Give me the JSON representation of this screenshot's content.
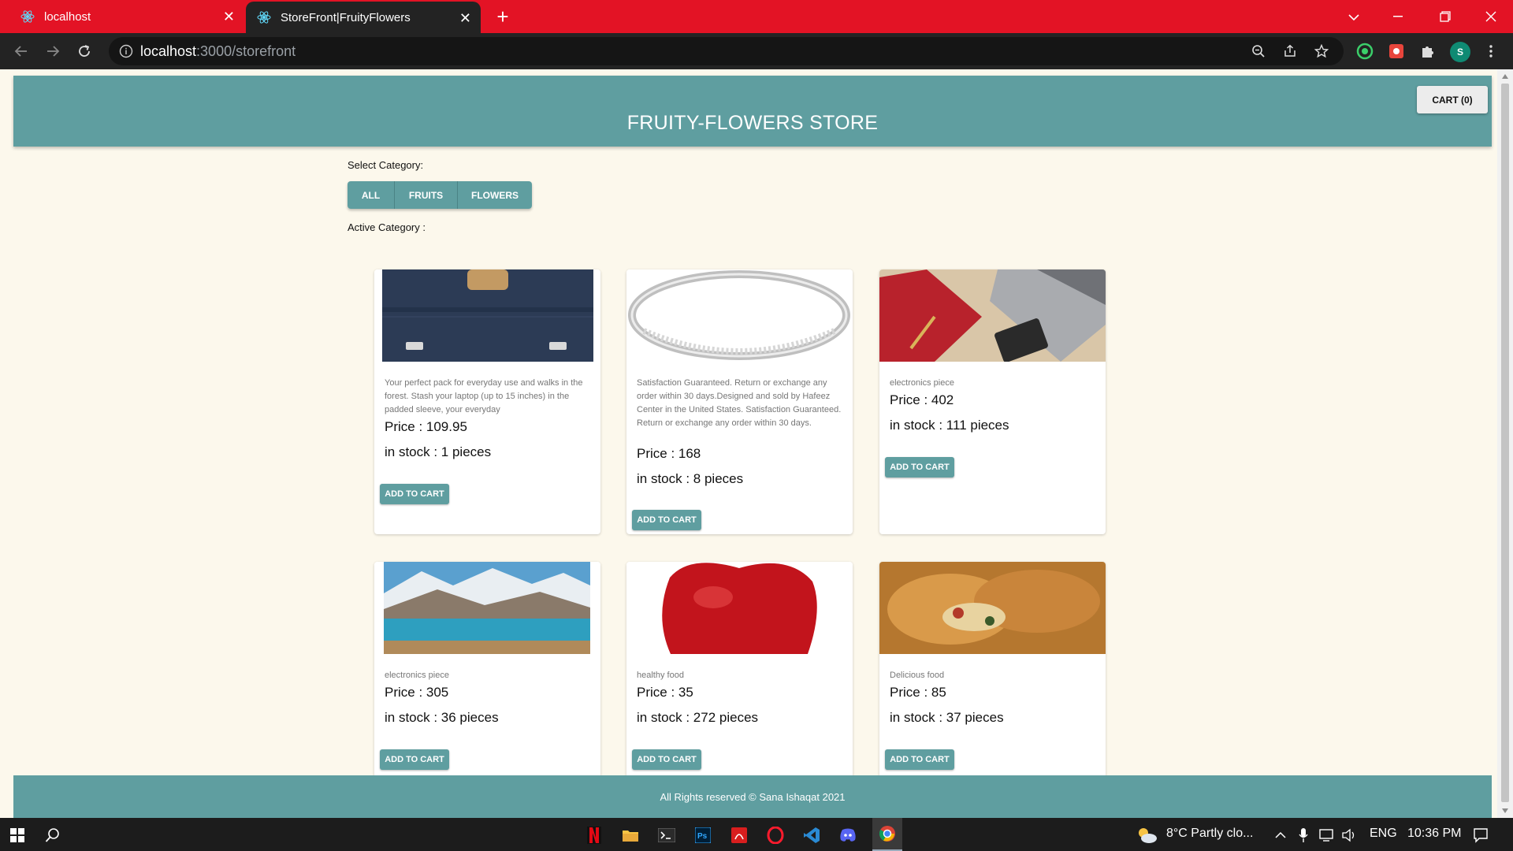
{
  "browser": {
    "tabs": [
      {
        "title": "localhost"
      },
      {
        "title": "StoreFront|FruityFlowers"
      }
    ],
    "url_host": "localhost",
    "url_rest": ":3000/storefront",
    "avatar_letter": "S"
  },
  "header": {
    "title": "FRUITY-FLOWERS STORE",
    "cart_label": "CART (0)"
  },
  "filters": {
    "select_label": "Select Category:",
    "categories": [
      "ALL",
      "FRUITS",
      "FLOWERS"
    ],
    "active_label": "Active Category :"
  },
  "products": [
    {
      "description": "Your perfect pack for everyday use and walks in the forest. Stash your laptop (up to 15 inches) in the padded sleeve, your everyday",
      "price": "Price : 109.95",
      "stock": "in stock : 1 pieces",
      "button": "ADD TO CART"
    },
    {
      "description": "Satisfaction Guaranteed. Return or exchange any order within 30 days.Designed and sold by Hafeez Center in the United States. Satisfaction Guaranteed. Return or exchange any order within 30 days.",
      "price": "Price : 168",
      "stock": "in stock : 8 pieces",
      "button": "ADD TO CART"
    },
    {
      "description": "electronics piece",
      "price": "Price : 402",
      "stock": "in stock : 111 pieces",
      "button": "ADD TO CART"
    },
    {
      "description": "electronics piece",
      "price": "Price : 305",
      "stock": "in stock : 36 pieces",
      "button": "ADD TO CART"
    },
    {
      "description": "healthy food",
      "price": "Price : 35",
      "stock": "in stock : 272 pieces",
      "button": "ADD TO CART"
    },
    {
      "description": "Delicious food",
      "price": "Price : 85",
      "stock": "in stock : 37 pieces",
      "button": "ADD TO CART"
    }
  ],
  "footer": {
    "text": "All Rights reserved © Sana Ishaqat 2021"
  },
  "taskbar": {
    "weather": "8°C  Partly clo...",
    "language": "ENG",
    "time": "10:36 PM"
  }
}
